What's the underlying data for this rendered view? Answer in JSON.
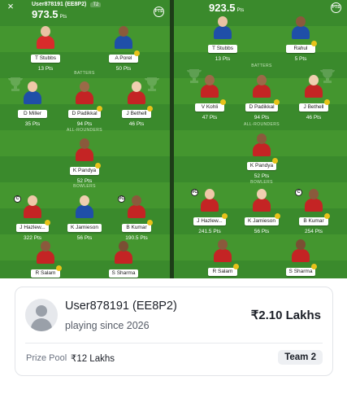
{
  "left_panel": {
    "user": "User878191 (EE8P2)",
    "tag": "T2",
    "score": "973.5",
    "score_unit": "Pts",
    "close_icon": "×",
    "pts_badge": "PTS",
    "sections": {
      "batters": "BATTERS",
      "allrounders": "ALL-ROUNDERS",
      "bowlers": "BOWLERS"
    }
  },
  "right_panel": {
    "score": "923.5",
    "score_unit": "Pts",
    "pts_badge": "PTS",
    "sections": {
      "batters": "BATTERS",
      "allrounders": "ALL-ROUNDERS",
      "bowlers": "BOWLERS"
    }
  },
  "left_players": [
    {
      "id": "stubbs",
      "name": "T Stubbs",
      "pts": "13 Pts",
      "skin": "#e9c3a3",
      "shirt": "#d92b2b",
      "dot": false
    },
    {
      "id": "porel",
      "name": "A Porel",
      "pts": "50 Pts",
      "skin": "#8a5a3c",
      "shirt": "#1f4fa8",
      "dot": true
    },
    {
      "id": "miller",
      "name": "D Miller",
      "pts": "35 Pts",
      "skin": "#efc8a8",
      "shirt": "#1f4fa8",
      "dot": false
    },
    {
      "id": "padikkal",
      "name": "D Padikkal",
      "pts": "94 Pts",
      "skin": "#9b6a48",
      "shirt": "#c42424",
      "dot": true
    },
    {
      "id": "bethell",
      "name": "J Bethell",
      "pts": "46 Pts",
      "skin": "#f0cfb0",
      "shirt": "#c42424",
      "dot": true
    },
    {
      "id": "pandya",
      "name": "K Pandya",
      "pts": "52 Pts",
      "skin": "#8a5a3c",
      "shirt": "#c42424",
      "dot": true
    },
    {
      "id": "hazlewood",
      "name": "J Hazlew...",
      "pts": "322 Pts",
      "skin": "#efc8a8",
      "shirt": "#c42424",
      "dot": true,
      "cap": "C"
    },
    {
      "id": "jamieson",
      "name": "K Jamieson",
      "pts": "56 Pts",
      "skin": "#f0cfb0",
      "shirt": "#1f4fa8",
      "dot": false
    },
    {
      "id": "kumar",
      "name": "B Kumar",
      "pts": "190.5 Pts",
      "skin": "#8a5a3c",
      "shirt": "#c42424",
      "dot": true,
      "cap": "VC"
    },
    {
      "id": "salam",
      "name": "R Salam",
      "pts": "",
      "skin": "#8a5a3c",
      "shirt": "#c42424",
      "dot": true
    },
    {
      "id": "sharma",
      "name": "S Sharma",
      "pts": "",
      "skin": "#7a4f33",
      "shirt": "#c42424",
      "dot": false
    }
  ],
  "right_players": [
    {
      "id": "stubbs",
      "name": "T Stubbs",
      "pts": "13 Pts",
      "skin": "#e9c3a3",
      "shirt": "#1f4fa8",
      "dot": false
    },
    {
      "id": "rahul",
      "name": "Rahul",
      "pts": "5 Pts",
      "skin": "#8a5a3c",
      "shirt": "#1f4fa8",
      "dot": true
    },
    {
      "id": "kohli",
      "name": "V Kohli",
      "pts": "47 Pts",
      "skin": "#9b6a48",
      "shirt": "#c42424",
      "dot": true
    },
    {
      "id": "padikkal",
      "name": "D Padikkal",
      "pts": "94 Pts",
      "skin": "#9b6a48",
      "shirt": "#c42424",
      "dot": true
    },
    {
      "id": "bethell",
      "name": "J Bethell",
      "pts": "46 Pts",
      "skin": "#f0cfb0",
      "shirt": "#c42424",
      "dot": true
    },
    {
      "id": "pandya",
      "name": "K Pandya",
      "pts": "52 Pts",
      "skin": "#8a5a3c",
      "shirt": "#c42424",
      "dot": true
    },
    {
      "id": "hazlewood",
      "name": "J Hazlew...",
      "pts": "241.5 Pts",
      "skin": "#efc8a8",
      "shirt": "#c42424",
      "dot": true,
      "cap": "VC"
    },
    {
      "id": "jamieson",
      "name": "K Jamieson",
      "pts": "56 Pts",
      "skin": "#f0cfb0",
      "shirt": "#c42424",
      "dot": true
    },
    {
      "id": "kumar",
      "name": "B Kumar",
      "pts": "254 Pts",
      "skin": "#8a5a3c",
      "shirt": "#c42424",
      "dot": true,
      "cap": "C"
    },
    {
      "id": "salam",
      "name": "R Salam",
      "pts": "",
      "skin": "#8a5a3c",
      "shirt": "#c42424",
      "dot": true
    },
    {
      "id": "sharma",
      "name": "S Sharma",
      "pts": "",
      "skin": "#7a4f33",
      "shirt": "#c42424",
      "dot": true
    }
  ],
  "card": {
    "user_name": "User878191 (EE8P2)",
    "since": "playing since 2026",
    "winnings": "₹2.10 Lakhs",
    "pool_label": "Prize Pool",
    "pool_value": "₹12 Lakhs",
    "team": "Team 2"
  }
}
